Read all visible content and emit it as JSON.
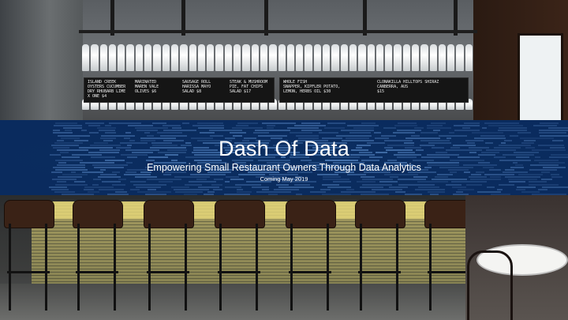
{
  "slide": {
    "title": "Dash Of Data",
    "subtitle": "Empowering Small Restaurant Owners Through Data Analytics",
    "coming_soon": "Coming  May 2019"
  },
  "menu_boards": {
    "left": [
      "ISLAND CREEK\nOYSTERS CUCUMBER\nDRY RHUBARB LIME\nX ONE $4",
      "MARINATED\nMAREN VALE\nOLIVES $6",
      "SAUSAGE ROLL\nHARISSA MAYO\nSALAD $8",
      "STEAK & MUSHROOM\nPIE, FAT CHIPS\nSALAD $17"
    ],
    "right": [
      "WHOLE FISH\nSNAPPER, KIPFLER POTATO,\nLEMON, HERBS OIL $30",
      "CLONAKILLA HILLTOPS SHIRAZ\nCANBERRA, AUS\n$15"
    ]
  },
  "colors": {
    "band": "#0b2f62",
    "code_glow": "#6fa6e8",
    "text": "#ffffff"
  }
}
